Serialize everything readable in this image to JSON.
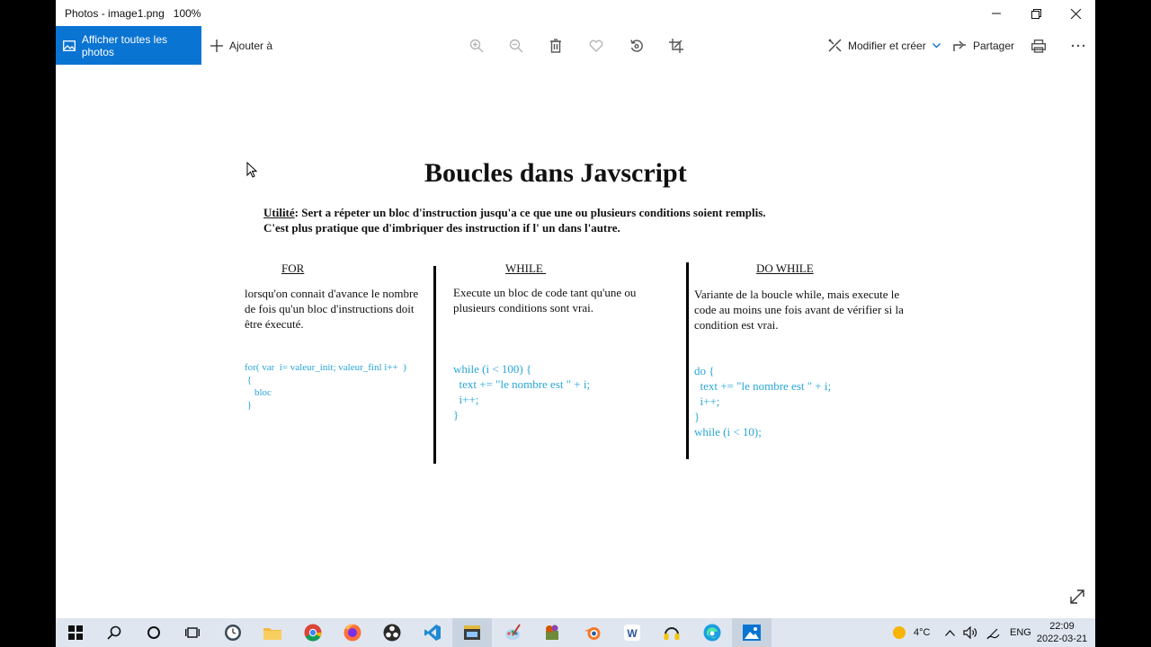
{
  "window": {
    "title": "Photos - image1.png",
    "zoom": "100%"
  },
  "toolbar": {
    "all_photos": "Afficher toutes les photos",
    "add_to": "Ajouter à",
    "edit_create": "Modifier et créer",
    "share": "Partager"
  },
  "doc": {
    "title": "Boucles dans Javscript",
    "intro_label": "Utilité",
    "intro_text": ": Sert a répeter un bloc d'instruction jusqu'a ce que une ou plusieurs conditions soient remplis. C'est plus pratique que d'imbriquer des instruction if l' un dans l'autre.",
    "columns": [
      {
        "heading": "FOR",
        "description": "lorsqu'on connait d'avance le nombre de fois qu'un bloc d'instructions doit être éxecuté.",
        "code": "for( var  i= valeur_init; valeur_finl i++  )\n {\n    bloc\n }"
      },
      {
        "heading": "WHILE ",
        "description": "Execute un bloc de code tant qu'une ou plusieurs conditions sont vrai.",
        "code": "while (i < 100) {\n  text += \"le nombre est \" + i;\n  i++;\n}"
      },
      {
        "heading": "DO WHILE",
        "description": "Variante de la boucle while, mais execute le code au moins une fois avant de vérifier si la condition est vrai.",
        "code": "do {\n  text += \"le nombre est \" + i;\n  i++;\n}\nwhile (i < 10);"
      }
    ]
  },
  "taskbar": {
    "temperature": "4°C",
    "language": "ENG",
    "time": "22:09",
    "date": "2022-03-21"
  },
  "colors": {
    "accent": "#0a74d3",
    "code": "#27a6d9",
    "taskbar": "#dfe6f0"
  }
}
